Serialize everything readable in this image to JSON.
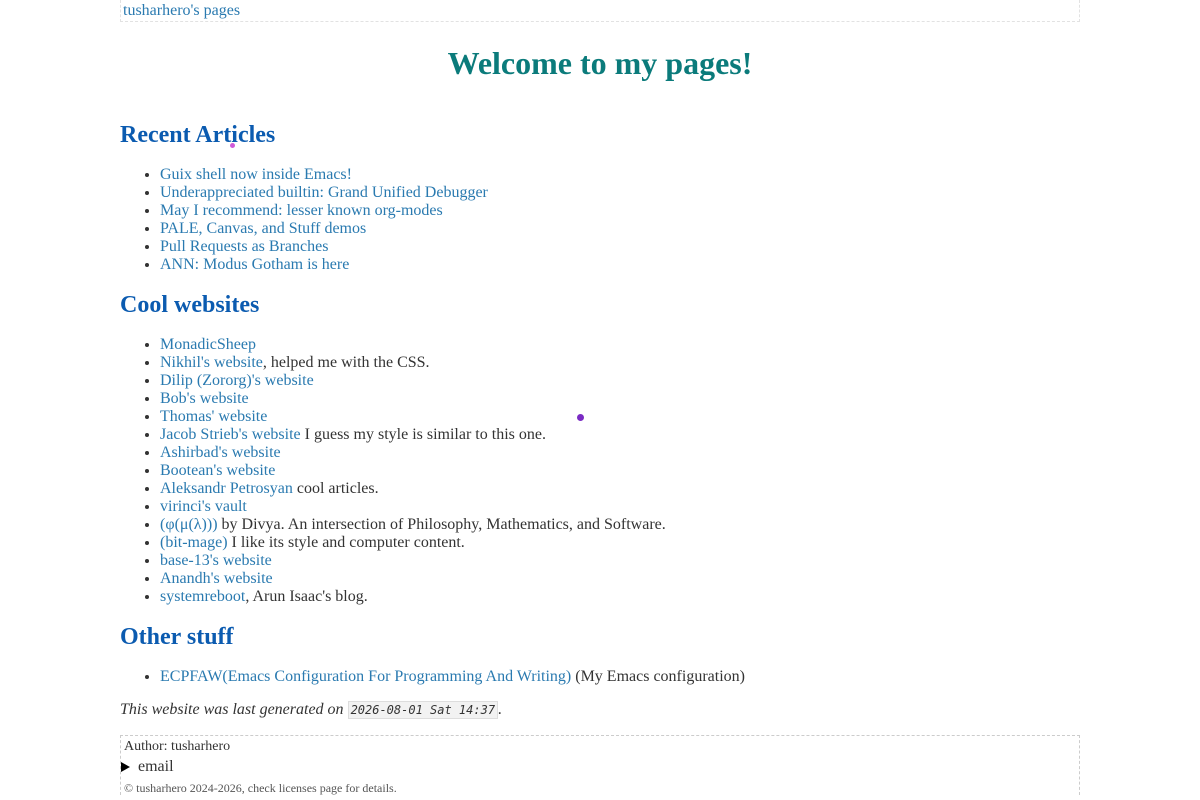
{
  "preamble": {
    "link": "tusharhero's pages"
  },
  "title": "Welcome to my pages!",
  "recent": {
    "heading": "Recent Articles",
    "items": [
      {
        "link": "Guix shell now inside Emacs!",
        "note": ""
      },
      {
        "link": "Underappreciated builtin: Grand Unified Debugger",
        "note": ""
      },
      {
        "link": "May I recommend: lesser known org-modes",
        "note": ""
      },
      {
        "link": "PALE, Canvas, and Stuff demos",
        "note": ""
      },
      {
        "link": "Pull Requests as Branches",
        "note": ""
      },
      {
        "link": "ANN: Modus Gotham is here",
        "note": ""
      }
    ]
  },
  "cool": {
    "heading": "Cool websites",
    "items": [
      {
        "link": "MonadicSheep",
        "note": ""
      },
      {
        "link": "Nikhil's website",
        "note": ", helped me with the CSS."
      },
      {
        "link": "Dilip (Zororg)'s website",
        "note": ""
      },
      {
        "link": "Bob's website",
        "note": ""
      },
      {
        "link": "Thomas' website",
        "note": ""
      },
      {
        "link": "Jacob Strieb's website",
        "note": " I guess my style is similar to this one."
      },
      {
        "link": "Ashirbad's website",
        "note": ""
      },
      {
        "link": "Bootean's website",
        "note": ""
      },
      {
        "link": "Aleksandr Petrosyan",
        "note": " cool articles."
      },
      {
        "link": "virinci's vault",
        "note": ""
      },
      {
        "link": "(φ(μ(λ)))",
        "note": " by Divya. An intersection of Philosophy, Mathematics, and Software."
      },
      {
        "link": "(bit-mage)",
        "note": " I like its style and computer content."
      },
      {
        "link": "base-13's website",
        "note": ""
      },
      {
        "link": "Anandh's website",
        "note": ""
      },
      {
        "link": "systemreboot",
        "note": ", Arun Isaac's blog."
      }
    ]
  },
  "other": {
    "heading": "Other stuff",
    "items": [
      {
        "link": "ECPFAW(Emacs Configuration For Programming And Writing)",
        "note": " (My Emacs configuration)"
      }
    ]
  },
  "generated": {
    "prefix": "This website was last generated on ",
    "timestamp": "2026-08-01 Sat 14:37",
    "suffix": "."
  },
  "postamble": {
    "author": "Author: tusharhero",
    "email_label": "email",
    "clipped": "© tusharhero 2024-2026, check licenses page for details."
  },
  "colors": {
    "title": "#0b7b7b",
    "heading": "#0b5bb0",
    "link": "#2a7ab0",
    "text": "#333333"
  }
}
